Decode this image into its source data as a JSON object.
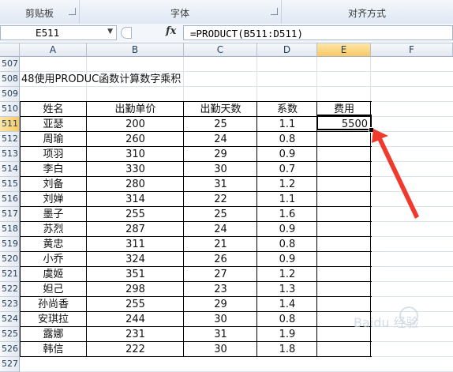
{
  "ribbon": {
    "groups": [
      {
        "label": "剪贴板"
      },
      {
        "label": "字体"
      },
      {
        "label": "对齐方式"
      }
    ]
  },
  "formula_bar": {
    "name_box": "E511",
    "fx_label": "fx",
    "formula": "=PRODUCT(B511:D511)"
  },
  "columns": [
    "A",
    "B",
    "C",
    "D",
    "E",
    "F"
  ],
  "selected_column": "E",
  "selected_row": "511",
  "title_cell": "48使用PRODUC函数计算数字乘积",
  "table": {
    "headers": [
      "姓名",
      "出勤单价",
      "出勤天数",
      "系数",
      "费用"
    ],
    "rows": [
      {
        "row": "511",
        "name": "亚瑟",
        "price": "200",
        "days": "25",
        "coef": "1.1",
        "cost": "5500"
      },
      {
        "row": "512",
        "name": "周瑜",
        "price": "260",
        "days": "24",
        "coef": "0.8",
        "cost": ""
      },
      {
        "row": "513",
        "name": "项羽",
        "price": "310",
        "days": "29",
        "coef": "0.9",
        "cost": ""
      },
      {
        "row": "514",
        "name": "李白",
        "price": "330",
        "days": "30",
        "coef": "0.7",
        "cost": ""
      },
      {
        "row": "515",
        "name": "刘备",
        "price": "280",
        "days": "31",
        "coef": "1.2",
        "cost": ""
      },
      {
        "row": "516",
        "name": "刘婵",
        "price": "314",
        "days": "22",
        "coef": "1.1",
        "cost": ""
      },
      {
        "row": "517",
        "name": "墨子",
        "price": "255",
        "days": "25",
        "coef": "1.6",
        "cost": ""
      },
      {
        "row": "518",
        "name": "苏烈",
        "price": "287",
        "days": "24",
        "coef": "0.9",
        "cost": ""
      },
      {
        "row": "519",
        "name": "黄忠",
        "price": "311",
        "days": "21",
        "coef": "0.8",
        "cost": ""
      },
      {
        "row": "520",
        "name": "小乔",
        "price": "324",
        "days": "26",
        "coef": "0.9",
        "cost": ""
      },
      {
        "row": "521",
        "name": "虞姬",
        "price": "351",
        "days": "27",
        "coef": "1.2",
        "cost": ""
      },
      {
        "row": "522",
        "name": "妲己",
        "price": "298",
        "days": "23",
        "coef": "1.3",
        "cost": ""
      },
      {
        "row": "523",
        "name": "孙尚香",
        "price": "255",
        "days": "29",
        "coef": "1.4",
        "cost": ""
      },
      {
        "row": "524",
        "name": "安琪拉",
        "price": "244",
        "days": "30",
        "coef": "0.8",
        "cost": ""
      },
      {
        "row": "525",
        "name": "露娜",
        "price": "231",
        "days": "31",
        "coef": "1.9",
        "cost": ""
      },
      {
        "row": "526",
        "name": "韩信",
        "price": "222",
        "days": "30",
        "coef": "1.8",
        "cost": ""
      }
    ]
  },
  "other_rows": [
    "507",
    "508",
    "509",
    "510",
    "527"
  ],
  "annotation": {
    "arrow_color": "#f03a2e"
  },
  "watermark": {
    "text": "Baidu 经验"
  }
}
